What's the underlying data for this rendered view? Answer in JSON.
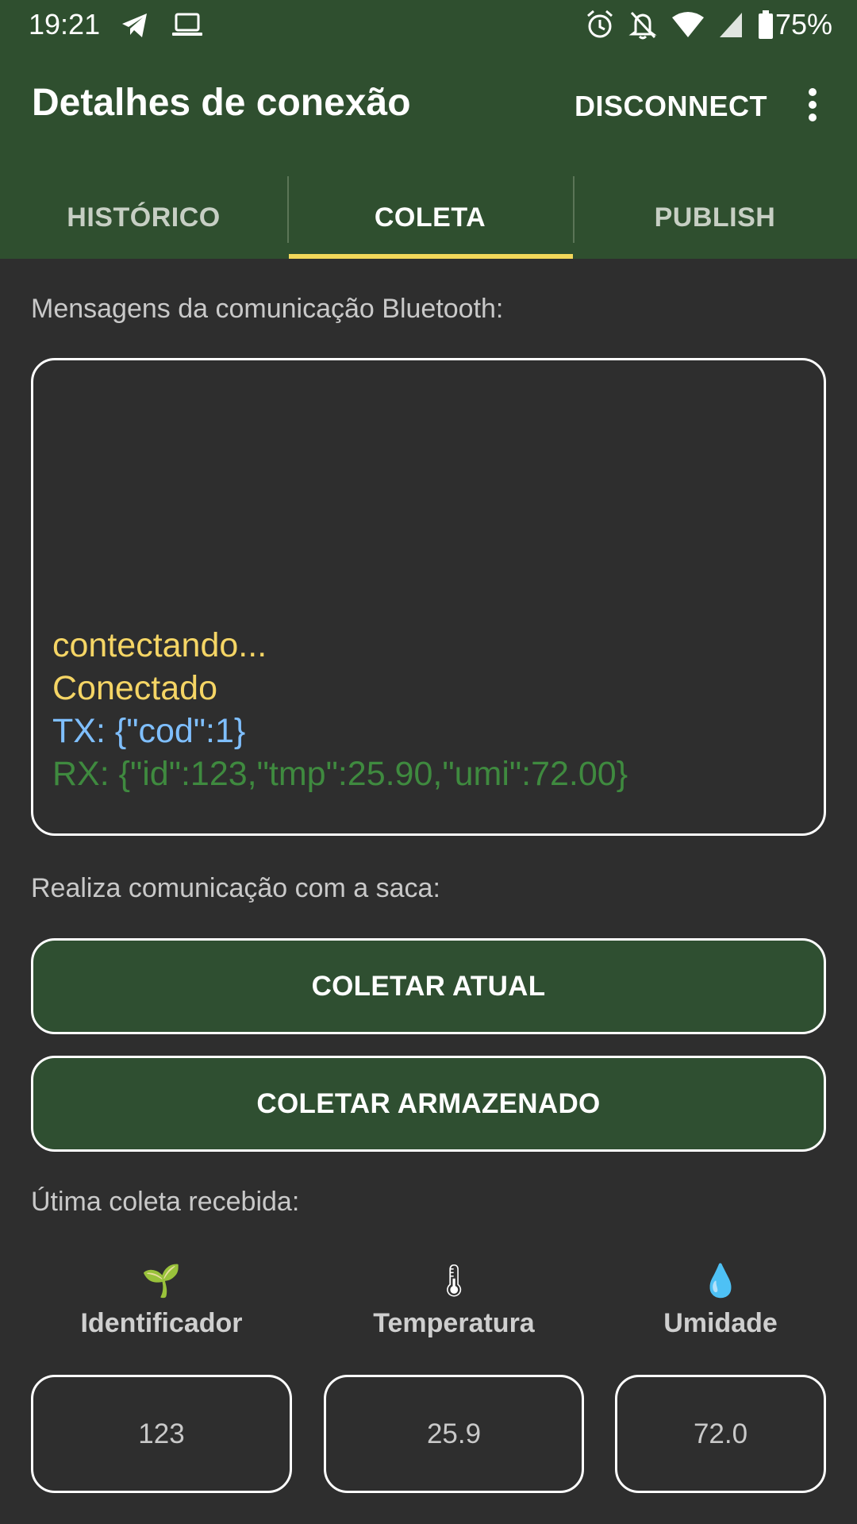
{
  "status_bar": {
    "time": "19:21",
    "battery": "75%",
    "left_icons": [
      "telegram-icon",
      "laptop-icon"
    ],
    "right_icons": [
      "alarm-icon",
      "notifications-off-icon",
      "wifi-icon",
      "signal-icon",
      "battery-icon"
    ]
  },
  "toolbar": {
    "title": "Detalhes de conexão",
    "disconnect_label": "DISCONNECT",
    "overflow_icon": "more-vert-icon"
  },
  "tabs": [
    {
      "label": "HISTÓRICO",
      "selected": false
    },
    {
      "label": "COLETA",
      "selected": true
    },
    {
      "label": "PUBLISH",
      "selected": false
    }
  ],
  "colors": {
    "primary": "#2f4f2f",
    "accent": "#f2d75a",
    "log_status": "#f5d565",
    "log_tx": "#7fbfff",
    "log_rx": "#3f8a3f"
  },
  "bluetooth": {
    "label": "Mensagens da comunicação Bluetooth:",
    "log": [
      {
        "text": "contectando...",
        "kind": "status"
      },
      {
        "text": "Conectado",
        "kind": "status"
      },
      {
        "text": "TX: {\"cod\":1}",
        "kind": "tx"
      },
      {
        "text": "RX: {\"id\":123,\"tmp\":25.90,\"umi\":72.00}",
        "kind": "rx"
      }
    ]
  },
  "actions": {
    "label": "Realiza comunicação com a saca:",
    "collect_current": "COLETAR ATUAL",
    "collect_stored": "COLETAR ARMAZENADO"
  },
  "last_collect": {
    "label": "Útima coleta recebida:",
    "metrics": [
      {
        "icon": "seedling-icon",
        "emoji": "🌱",
        "title": "Identificador",
        "value": "123"
      },
      {
        "icon": "thermometer-icon",
        "emoji": "🌡",
        "title": "Temperatura",
        "value": "25.9"
      },
      {
        "icon": "droplet-icon",
        "emoji": "💧",
        "title": "Umidade",
        "value": "72.0"
      }
    ]
  }
}
